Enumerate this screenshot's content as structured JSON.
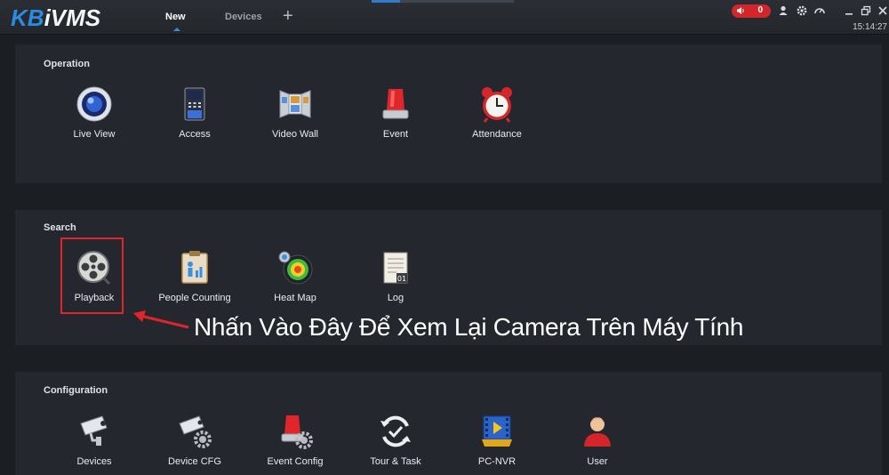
{
  "app": {
    "logo_kb": "KB",
    "logo_ivms": "iVMS"
  },
  "tabs": [
    {
      "label": "New",
      "active": true
    },
    {
      "label": "Devices",
      "active": false
    }
  ],
  "titlebar": {
    "alarm_count": "0",
    "clock": "15:14:27"
  },
  "sections": {
    "operation": {
      "title": "Operation",
      "items": [
        {
          "label": "Live View",
          "icon": "live-view-icon"
        },
        {
          "label": "Access",
          "icon": "access-icon"
        },
        {
          "label": "Video Wall",
          "icon": "video-wall-icon"
        },
        {
          "label": "Event",
          "icon": "event-icon"
        },
        {
          "label": "Attendance",
          "icon": "alarm-clock-icon"
        }
      ]
    },
    "search": {
      "title": "Search",
      "items": [
        {
          "label": "Playback",
          "icon": "film-reel-icon"
        },
        {
          "label": "People Counting",
          "icon": "people-counting-icon"
        },
        {
          "label": "Heat Map",
          "icon": "heat-map-icon"
        },
        {
          "label": "Log",
          "icon": "log-icon"
        }
      ]
    },
    "configuration": {
      "title": "Configuration",
      "items": [
        {
          "label": "Devices",
          "icon": "camera-icon"
        },
        {
          "label": "Device CFG",
          "icon": "camera-gear-icon"
        },
        {
          "label": "Event Config",
          "icon": "event-gear-icon"
        },
        {
          "label": "Tour & Task",
          "icon": "refresh-check-icon"
        },
        {
          "label": "PC-NVR",
          "icon": "video-file-icon"
        },
        {
          "label": "User",
          "icon": "user-icon"
        }
      ]
    }
  },
  "annotation": {
    "text": "Nhấn Vào Đây Để Xem Lại Camera Trên Máy Tính"
  },
  "colors": {
    "background": "#1b1e23",
    "panel": "#24282e",
    "accent": "#2f8fe6",
    "alarm": "#d2262a",
    "highlight": "#e0242a"
  }
}
